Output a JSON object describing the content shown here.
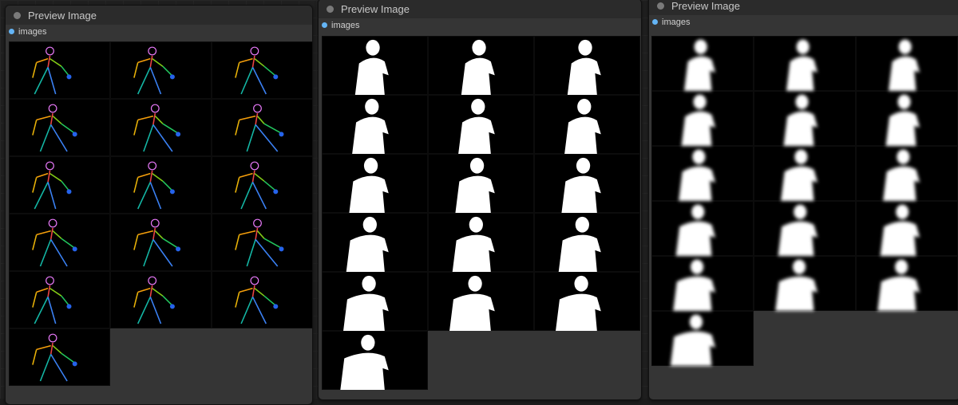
{
  "nodes": [
    {
      "title": "Preview Image",
      "output_label": "images",
      "kind": "pose",
      "image_count": 16
    },
    {
      "title": "Preview Image",
      "output_label": "images",
      "kind": "mask",
      "image_count": 16
    },
    {
      "title": "Preview Image",
      "output_label": "images",
      "kind": "blur-mask",
      "image_count": 16
    }
  ],
  "colors": {
    "slot": "#64b5f6",
    "node_bg": "#353535",
    "header_bg": "#2b2b2b",
    "canvas": "#202020"
  }
}
